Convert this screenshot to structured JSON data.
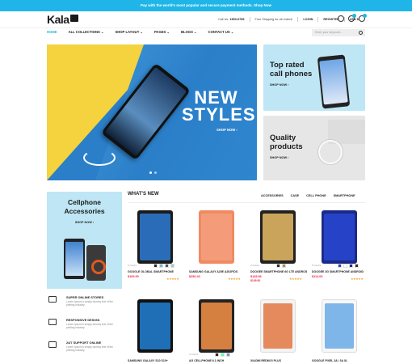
{
  "topbar": {
    "text": "Pay with the world's most popular and secure payment methods. Shop Now"
  },
  "header": {
    "logo": "Kala",
    "phone_label": "Call Us:",
    "phone": "1900-6789",
    "shipping": "Free Shipping for all orders!",
    "login": "LOGIN",
    "register": "REGISTER",
    "currency": "USD $"
  },
  "nav": {
    "items": [
      {
        "label": "HOME"
      },
      {
        "label": "ALL COLLECTIONS ⌄"
      },
      {
        "label": "SHOP LAYOUT ⌄"
      },
      {
        "label": "PAGES ⌄"
      },
      {
        "label": "BLOGS ⌄"
      },
      {
        "label": "CONTACT US ⌄"
      }
    ],
    "search_placeholder": "Enter your keyword..."
  },
  "hero": {
    "title_line1": "NEW",
    "title_line2": "STYLES",
    "cta": "SHOP NOW ›"
  },
  "banners": [
    {
      "title": "Top rated call phones",
      "cta": "SHOP NOW ›"
    },
    {
      "title": "Quality products",
      "cta": "SHOP NOW ›"
    }
  ],
  "cell_banner": {
    "title": "Cellphone Accessories",
    "cta": "SHOP NOW ›"
  },
  "features": [
    {
      "title": "SUPER ONLINE STORES",
      "desc": "Lorem Ipsum is simply dummy text of the printing industry."
    },
    {
      "title": "RESPONSIVE DESIGN",
      "desc": "Lorem Ipsum is simply dummy text of the printing industry."
    },
    {
      "title": "24/7 SUPPORT ONLINE",
      "desc": "Lorem Ipsum is simply dummy text of the printing industry."
    }
  ],
  "whats_new": {
    "title": "WHAT'S NEW",
    "tabs": [
      "ACCESSORIES",
      "CASE",
      "CELL PHONE",
      "SMARTPHONE"
    ]
  },
  "products": [
    {
      "name": "GOOGLE GLOBAL SMARTPHONE",
      "meta": "6 Colors",
      "price": "$109.90",
      "old": "",
      "color": "#1b1b1b",
      "screen": "#2b6cb8"
    },
    {
      "name": "SAMSUNG GALAXY A20E A202F/DS",
      "meta": "",
      "price": "$256.40",
      "old": "",
      "color": "#f08a62",
      "screen": "#f49c79"
    },
    {
      "name": "DOOGEE SMARTPHONE 6G LTE ANDROID",
      "meta": "3 Colors",
      "price": "$145.56",
      "old": "$149.00",
      "color": "#222",
      "screen": "#c9a45a"
    },
    {
      "name": "DOOGEE 3G SMARTPHONE ANDROID",
      "meta": "5 Colors",
      "price": "$114.00",
      "old": "",
      "color": "#1b2a88",
      "screen": "#2643c8"
    },
    {
      "name": "SAMSUNG GALAXY S10 S10+",
      "meta": "",
      "price": "",
      "old": "",
      "color": "#111",
      "screen": "#1e6fb6"
    },
    {
      "name": "AG CELLPHONE 6.1 INCH",
      "meta": "3 Colors",
      "price": "",
      "old": "",
      "color": "#222",
      "screen": "#d58040"
    },
    {
      "name": "XIAOMI REDMI 5 PLUS",
      "meta": "",
      "price": "",
      "old": "",
      "color": "#f3f3f3",
      "screen": "#e48a5d"
    },
    {
      "name": "GOOGLE PIXEL 3A / 3A XL",
      "meta": "",
      "price": "",
      "old": "",
      "color": "#f7f7f7",
      "screen": "#7fb6ea"
    }
  ],
  "rating": "★★★★★",
  "colors": {
    "accent": "#1fb5e8",
    "price": "#e24",
    "star": "#f3a73b"
  }
}
